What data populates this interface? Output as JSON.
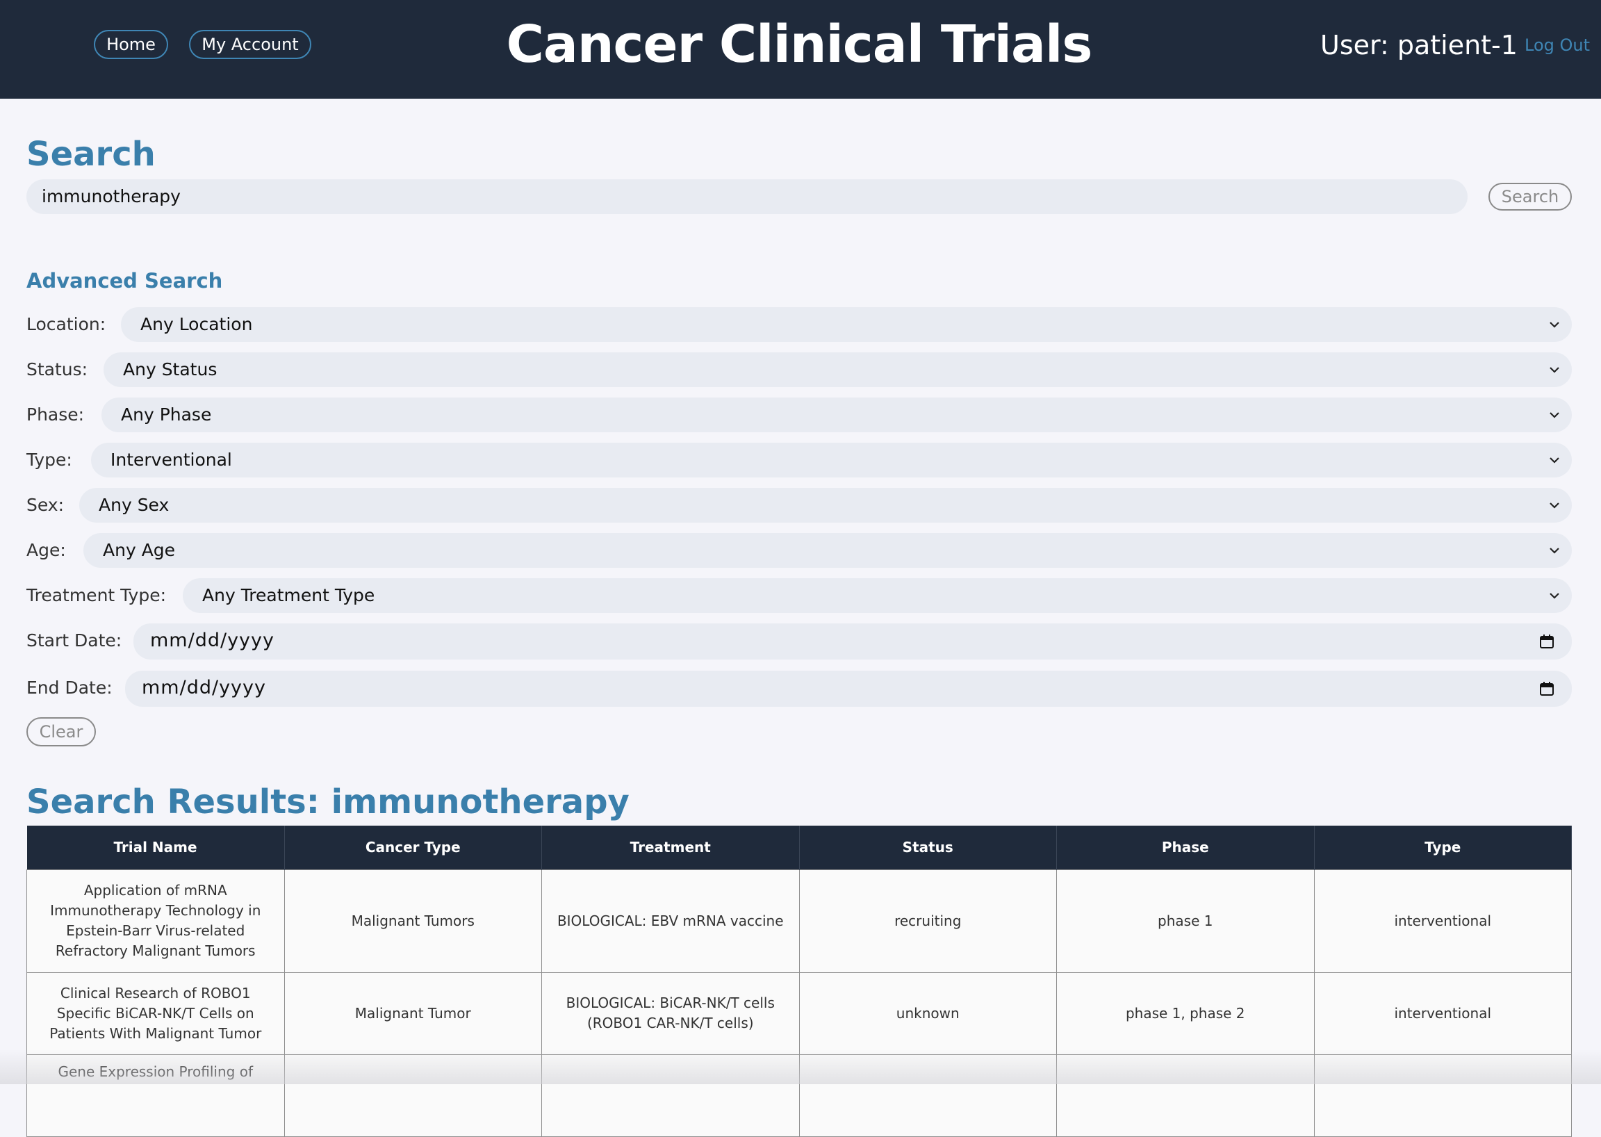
{
  "header": {
    "home_label": "Home",
    "account_label": "My Account",
    "title": "Cancer Clinical Trials",
    "user_label": "User: patient-1",
    "logout_label": "Log Out"
  },
  "search": {
    "heading": "Search",
    "query": "immunotherapy",
    "button_label": "Search"
  },
  "advanced": {
    "heading": "Advanced Search",
    "filters": [
      {
        "label": "Location:",
        "value": "Any Location",
        "kind": "select"
      },
      {
        "label": "Status:",
        "value": "Any Status",
        "kind": "select"
      },
      {
        "label": "Phase:",
        "value": "Any Phase",
        "kind": "select"
      },
      {
        "label": "Type:",
        "value": "Interventional",
        "kind": "select"
      },
      {
        "label": "Sex:",
        "value": "Any Sex",
        "kind": "select"
      },
      {
        "label": "Age:",
        "value": "Any Age",
        "kind": "select"
      },
      {
        "label": "Treatment Type:",
        "value": "Any Treatment Type",
        "kind": "select"
      },
      {
        "label": "Start Date:",
        "value": "mm/dd/yyyy",
        "kind": "date"
      },
      {
        "label": "End Date:",
        "value": "mm/dd/yyyy",
        "kind": "date"
      }
    ],
    "clear_label": "Clear"
  },
  "results": {
    "heading": "Search Results: immunotherapy",
    "columns": [
      "Trial Name",
      "Cancer Type",
      "Treatment",
      "Status",
      "Phase",
      "Type"
    ],
    "rows": [
      [
        "Application of mRNA Immunotherapy Technology in Epstein-Barr Virus-related Refractory Malignant Tumors",
        "Malignant Tumors",
        "BIOLOGICAL: EBV mRNA vaccine",
        "recruiting",
        "phase 1",
        "interventional"
      ],
      [
        "Clinical Research of ROBO1 Specific BiCAR-NK/T Cells on Patients With Malignant Tumor",
        "Malignant Tumor",
        "BIOLOGICAL: BiCAR-NK/T cells (ROBO1 CAR-NK/T cells)",
        "unknown",
        "phase 1, phase 2",
        "interventional"
      ],
      [
        "Gene Expression Profiling of",
        "",
        "",
        "",
        "",
        ""
      ]
    ]
  },
  "colors": {
    "header_bg": "#1f2a3b",
    "accent": "#3a7fab",
    "field_bg": "#e8ebf2",
    "page_bg": "#f5f5fa"
  },
  "icons": {
    "select": "chevron-down-icon",
    "date": "calendar-icon"
  }
}
